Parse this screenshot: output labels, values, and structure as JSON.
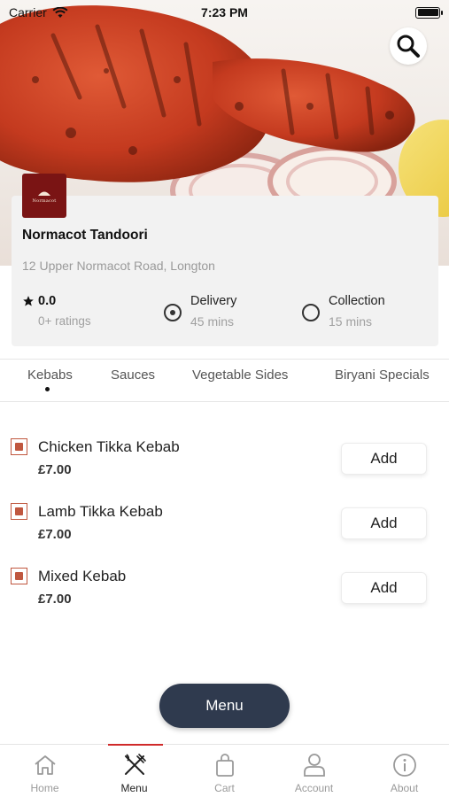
{
  "status_bar": {
    "carrier": "Carrier",
    "time": "7:23 PM"
  },
  "header": {
    "search_icon": "search-icon"
  },
  "restaurant": {
    "logo_text": "Normacot",
    "name": "Normacot Tandoori",
    "address": "12 Upper Normacot Road, Longton",
    "rating": "0.0",
    "ratings_count": "0+ ratings",
    "options": [
      {
        "label": "Delivery",
        "time": "45 mins",
        "selected": true
      },
      {
        "label": "Collection",
        "time": "15 mins",
        "selected": false
      }
    ]
  },
  "categories": [
    {
      "label": "Kebabs",
      "active": true
    },
    {
      "label": "Sauces",
      "active": false
    },
    {
      "label": "Vegetable Sides",
      "active": false
    },
    {
      "label": "Biryani Specials",
      "active": false
    }
  ],
  "items": [
    {
      "name": "Chicken Tikka Kebab",
      "price": "£7.00",
      "add_label": "Add"
    },
    {
      "name": "Lamb Tikka Kebab",
      "price": "£7.00",
      "add_label": "Add"
    },
    {
      "name": "Mixed Kebab",
      "price": "£7.00",
      "add_label": "Add"
    }
  ],
  "menu_button": {
    "label": "Menu"
  },
  "bottom_nav": [
    {
      "label": "Home",
      "icon": "home-icon",
      "active": false
    },
    {
      "label": "Menu",
      "icon": "fork-knife-icon",
      "active": true
    },
    {
      "label": "Cart",
      "icon": "bag-icon",
      "active": false
    },
    {
      "label": "Account",
      "icon": "user-icon",
      "active": false
    },
    {
      "label": "About",
      "icon": "info-icon",
      "active": false
    }
  ],
  "colors": {
    "accent": "#d02a2a",
    "veg_marker": "#c0573f",
    "fab": "#2f3a4e",
    "logo_bg": "#7a1414"
  }
}
